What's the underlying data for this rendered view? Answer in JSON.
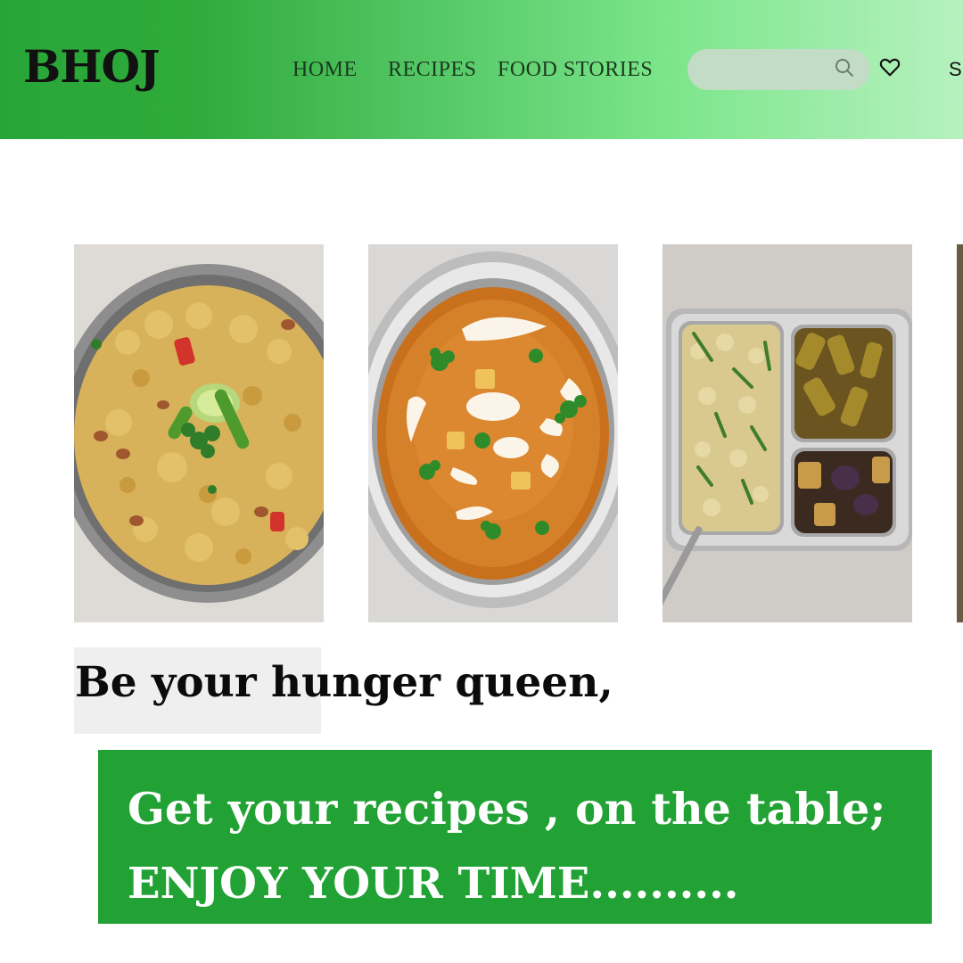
{
  "header": {
    "logo": "BHOJ",
    "nav": [
      {
        "label": "HOME"
      },
      {
        "label": "RECIPES"
      },
      {
        "label": "FOOD STORIES"
      }
    ],
    "search": {
      "placeholder": "",
      "value": ""
    },
    "signin_partial": "S",
    "icons": [
      "search-icon",
      "heart-icon"
    ]
  },
  "gallery": {
    "cards": [
      {
        "dish": "poha-bowl"
      },
      {
        "dish": "paneer-curry-bowl"
      },
      {
        "dish": "rice-and-sabzi-plate"
      },
      {
        "dish": "partial-card"
      }
    ]
  },
  "hero": {
    "tagline": "Be your hunger queen,",
    "banner_line1": "Get your recipes , on the table;",
    "banner_line2": "ENJOY YOUR TIME.........."
  },
  "colors": {
    "brand_green": "#22a234",
    "header_gradient_start": "#27a637",
    "header_gradient_end": "#b6f1bf"
  }
}
